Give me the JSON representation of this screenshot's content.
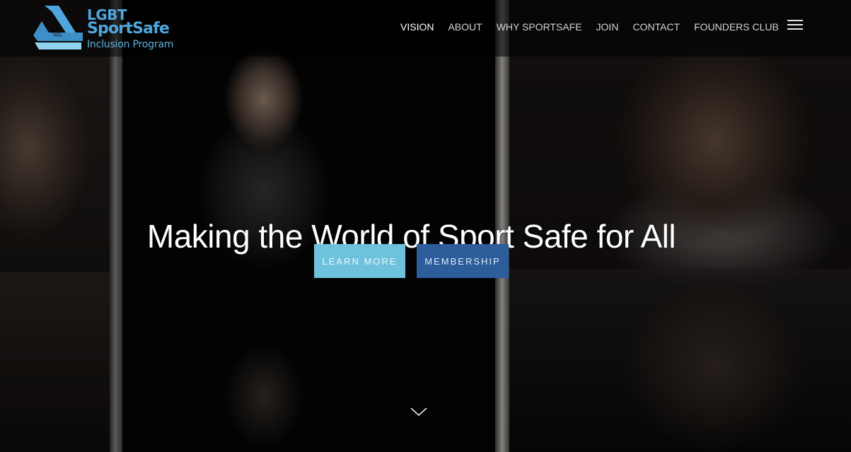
{
  "brand": {
    "line1": "LGBT",
    "line2": "SportSafe",
    "line3": "Inclusion Program",
    "colors": {
      "primary": "#4ea6dc",
      "light": "#8fd3ee"
    }
  },
  "nav": {
    "items": [
      {
        "label": "VISION",
        "active": true
      },
      {
        "label": "ABOUT",
        "active": false
      },
      {
        "label": "WHY SPORTSAFE",
        "active": false
      },
      {
        "label": "JOIN",
        "active": false
      },
      {
        "label": "CONTACT",
        "active": false
      },
      {
        "label": "FOUNDERS CLUB",
        "active": false
      }
    ],
    "menu_icon": "hamburger-icon"
  },
  "hero": {
    "headline": "Making the World of Sport Safe for All",
    "buttons": {
      "learn_more": "LEARN MORE",
      "membership": "MEMBERSHIP"
    },
    "scroll_icon": "chevron-down-icon",
    "colors": {
      "learn_more": "#6fc2dc",
      "membership": "#2e5d9c"
    }
  }
}
